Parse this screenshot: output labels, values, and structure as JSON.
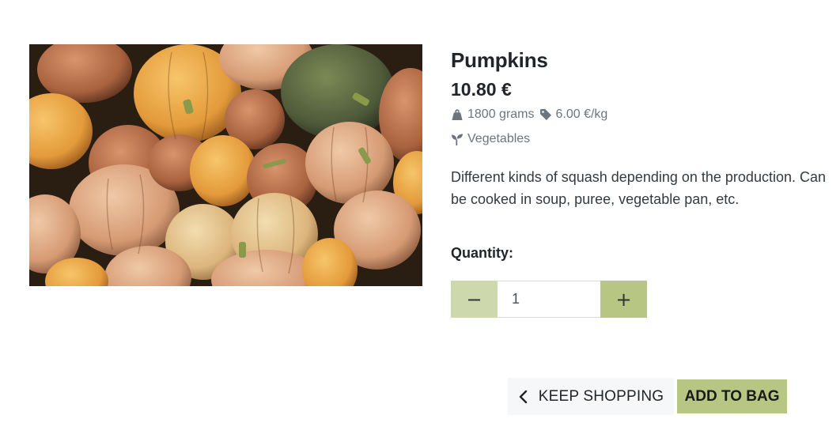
{
  "product": {
    "image_alt": "Pumpkins",
    "title": "Pumpkins",
    "price": "10.80 €",
    "weight": "1800 grams",
    "unit_price": "6.00 €/kg",
    "category": "Vegetables",
    "description": "Different kinds of squash depending on the production. Can be cooked in soup, puree, vegetable pan, etc."
  },
  "quantity": {
    "label": "Quantity:",
    "value": "1",
    "minus_symbol": "−",
    "plus_symbol": "+"
  },
  "actions": {
    "keep_shopping": "KEEP SHOPPING",
    "add_to_bag": "ADD TO BAG"
  },
  "icons": {
    "weight": "weight-icon",
    "price_tag": "tag-icon",
    "category": "seedling-icon",
    "back": "chevron-left-icon"
  },
  "colors": {
    "accent": "#b7c682",
    "accent_light": "#cdd9ad",
    "muted_text": "#6c757d",
    "secondary_button": "#f6f7f9"
  }
}
